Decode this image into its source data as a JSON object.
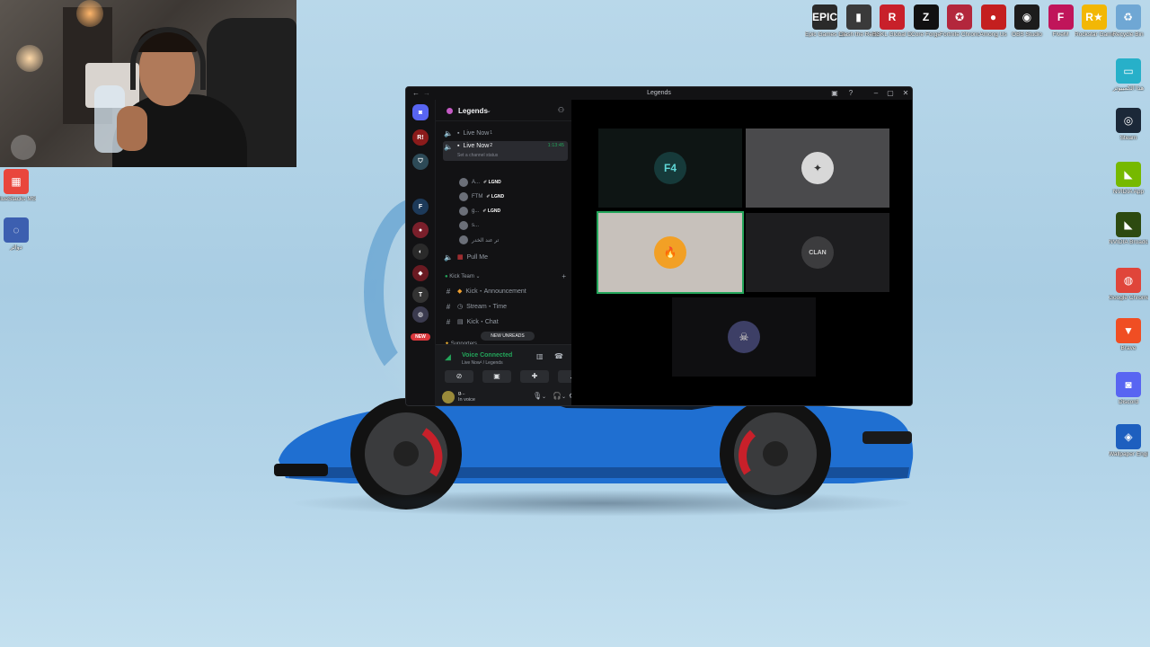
{
  "desktop_icons_top": [
    {
      "label": "Epic Games Launcher",
      "icon": "epic-games-icon",
      "glyph": "EPIC",
      "color": "#2a2a2a"
    },
    {
      "label": "Clash the Rebellion",
      "icon": "game-icon",
      "glyph": "▮",
      "color": "#3a3a3a"
    },
    {
      "label": "RSKL Global Domination",
      "icon": "r-logo-icon",
      "glyph": "R",
      "color": "#c8202a"
    },
    {
      "label": "Core Forge",
      "icon": "forge-icon",
      "glyph": "Z",
      "color": "#111111"
    },
    {
      "label": "Fortnite Chrono...",
      "icon": "fortnite-icon",
      "glyph": "✪",
      "color": "#b3273c"
    },
    {
      "label": "Among Us",
      "icon": "among-us-icon",
      "glyph": "●",
      "color": "#c41f1f"
    },
    {
      "label": "OBS Studio",
      "icon": "obs-icon",
      "glyph": "◉",
      "color": "#1c1c1c"
    },
    {
      "label": "FiveM",
      "icon": "fivem-icon",
      "glyph": "F",
      "color": "#c0155a"
    },
    {
      "label": "Rockstar Games...",
      "icon": "rockstar-icon",
      "glyph": "R★",
      "color": "#f2b705"
    },
    {
      "label": "Recycle Bin",
      "icon": "recycle-bin-icon",
      "glyph": "♻",
      "color": "#6fa7d4"
    }
  ],
  "desktop_icons_right": [
    {
      "label": "هذا الكمبيوتر",
      "icon": "this-pc-icon",
      "glyph": "▭",
      "color": "#27b0c9"
    },
    {
      "label": "Steam",
      "icon": "steam-icon",
      "glyph": "◎",
      "color": "#1b2838"
    },
    {
      "label": "NVIDIA App",
      "icon": "nvidia-icon",
      "glyph": "◣",
      "color": "#76b900"
    },
    {
      "label": "NVIDIA Broadcast",
      "icon": "nvidia-broadcast-icon",
      "glyph": "◣",
      "color": "#2d4a10"
    },
    {
      "label": "Google Chrome",
      "icon": "chrome-icon",
      "glyph": "◍",
      "color": "#e0453a"
    },
    {
      "label": "Brave",
      "icon": "brave-icon",
      "glyph": "▼",
      "color": "#f04e23"
    },
    {
      "label": "Discord",
      "icon": "discord-icon",
      "glyph": "◙",
      "color": "#5865f2"
    },
    {
      "label": "Wallpaper Engine",
      "icon": "wallpaper-engine-icon",
      "glyph": "◈",
      "color": "#1d5fbf"
    }
  ],
  "desktop_icons_left": [
    {
      "label": "BlueStacks MSI2 Insta...",
      "icon": "bluestacks-icon",
      "glyph": "▦",
      "color": "#e9463c"
    },
    {
      "label": "دوائر",
      "icon": "app-icon",
      "glyph": "◌",
      "color": "#3c5fb0"
    }
  ],
  "discord": {
    "title": "Legends",
    "guild_name": "Legends",
    "servers": [
      {
        "name": "server-r",
        "glyph": "R!",
        "color": "#8b1b1b"
      },
      {
        "name": "server-shield",
        "glyph": "⛉",
        "color": "#2d4a57"
      },
      {
        "name": "server-f",
        "glyph": "F",
        "color": "#1d3a5a"
      },
      {
        "name": "server-red",
        "glyph": "●",
        "color": "#7a1f2b"
      },
      {
        "name": "server-dark",
        "glyph": "◐",
        "color": "#2a2a2a"
      },
      {
        "name": "server-red2",
        "glyph": "◆",
        "color": "#6a1a22"
      },
      {
        "name": "server-t",
        "glyph": "T",
        "color": "#333333"
      },
      {
        "name": "server-globe",
        "glyph": "◍",
        "color": "#3b3b4f"
      }
    ],
    "new_badge": "NEW",
    "channels": {
      "live_now_1": "Live Now",
      "live_now_1_sup": "1",
      "live_now_2": "Live Now",
      "live_now_2_sup": "2",
      "live_time": "1:13:45",
      "set_status": "Set a channel status",
      "members": [
        {
          "name": "A...",
          "tag": "LGND"
        },
        {
          "name": "FTM",
          "tag": "LGND"
        },
        {
          "name": "g...",
          "tag": "LGND"
        },
        {
          "name": "s...",
          "tag": ""
        },
        {
          "name": "تر عند الخدر",
          "tag": ""
        }
      ],
      "pull_me": "Pull Me",
      "category_kick": "Kick Team",
      "kick_announcement": "Kick・Announcement",
      "stream_time": "Stream・Time",
      "kick_chat": "Kick・Chat",
      "category_supporters": "Supporters",
      "new_unreads": "NEW UNREADS"
    },
    "voice": {
      "status": "Voice Connected",
      "channel": "Live Now² / Legends"
    },
    "user": {
      "name": "g...",
      "status": "In voice"
    },
    "tiles": [
      {
        "name": "tile-f4",
        "glyph": "F4",
        "bg": "#0e1514",
        "avatar_bg": "#163a3a",
        "avatar_fg": "#5fd6d6",
        "highlight": false
      },
      {
        "name": "tile-grey",
        "glyph": "✦",
        "bg": "#4a4a4c",
        "avatar_bg": "#d8d8d8",
        "avatar_fg": "#333333",
        "highlight": false
      },
      {
        "name": "tile-fire",
        "glyph": "🔥",
        "bg": "#c7c1bb",
        "avatar_bg": "#f2a025",
        "avatar_fg": "#ffffff",
        "highlight": true
      },
      {
        "name": "tile-clan",
        "glyph": "CLAN",
        "bg": "#1d1d1f",
        "avatar_bg": "#3c3c3e",
        "avatar_fg": "#cfcfcf",
        "highlight": false
      },
      {
        "name": "tile-skull",
        "glyph": "☠",
        "bg": "#0f0f11",
        "avatar_bg": "#3d3f66",
        "avatar_fg": "#e8e3d6",
        "highlight": false
      }
    ]
  }
}
